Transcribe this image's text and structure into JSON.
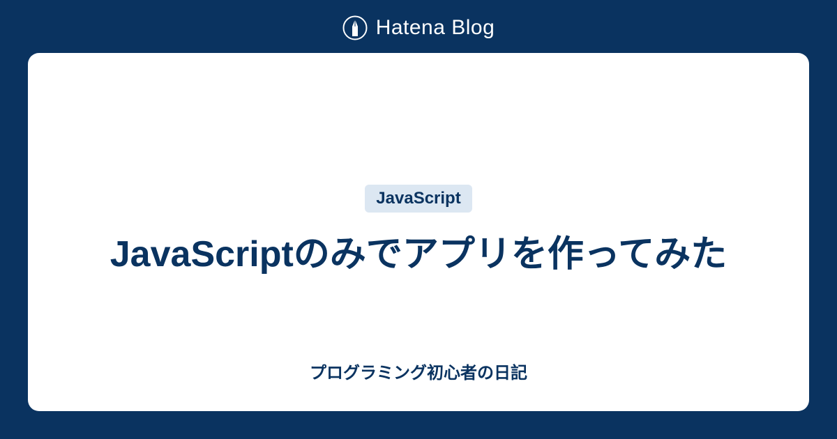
{
  "header": {
    "brand_text": "Hatena Blog"
  },
  "card": {
    "tag": "JavaScript",
    "title": "JavaScriptのみでアプリを作ってみた",
    "subtitle": "プログラミング初心者の日記"
  },
  "colors": {
    "background": "#0a3360",
    "card_background": "#ffffff",
    "tag_background": "#dce7f2",
    "text_primary": "#0a3360"
  }
}
